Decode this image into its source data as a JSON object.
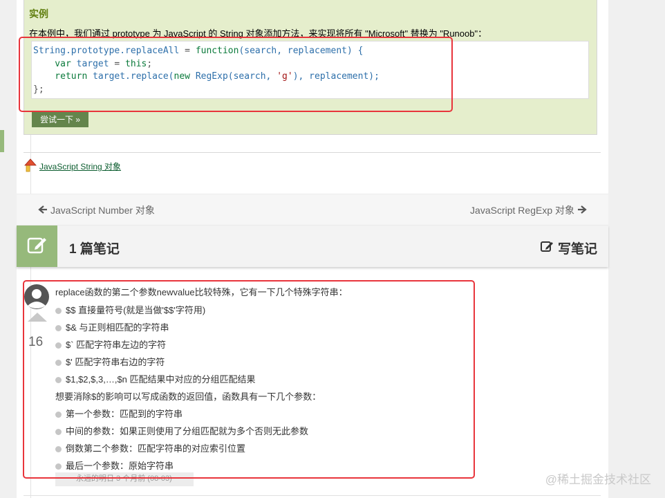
{
  "example": {
    "title": "实例",
    "description": "在本例中，我们通过 prototype 为 JavaScript 的 String 对象添加方法，来实现将所有 \"Microsoft\" 替换为 \"Runoob\"：",
    "code": {
      "line1": {
        "a": "String.prototype.replaceAll",
        "b": " = ",
        "c": "function",
        "d": "(search, replacement) {"
      },
      "line2": {
        "a": "    var ",
        "b": "target",
        "c": " = ",
        "d": "this",
        "e": ";"
      },
      "line3": {
        "a": "    return ",
        "b": "target.replace(",
        "c": "new ",
        "d": "RegExp(search, ",
        "e": "'g'",
        "f": "), replacement);"
      },
      "line4": "};"
    },
    "try_button": "尝试一下 »"
  },
  "back_link": "JavaScript String 对象",
  "nav": {
    "prev": "JavaScript Number 对象",
    "next": "JavaScript RegExp 对象"
  },
  "notes": {
    "count_label": "1 篇笔记",
    "write_label": "写笔记"
  },
  "note": {
    "votes": "16",
    "intro": "replace函数的第二个参数newvalue比较特殊，它有一下几个特殊字符串：",
    "special_items": [
      "$$  直接量符号(就是当做'$$'字符用)",
      "$&  与正则相匹配的字符串",
      "$`  匹配字符串左边的字符",
      "$'  匹配字符串右边的字符",
      "$1,$2,$,3,…,$n  匹配结果中对应的分组匹配结果"
    ],
    "func_intro": "想要消除$的影响可以写成函数的返回值，函数具有一下几个参数：",
    "func_items": [
      "第一个参数：匹配到的字符串",
      "中间的参数：如果正则使用了分组匹配就为多个否则无此参数",
      "倒数第二个参数：匹配字符串的对应索引位置",
      "最后一个参数：原始字符串"
    ],
    "author": "永远的明日 3 个月前 (08-03)"
  },
  "watermark": "@稀土掘金技术社区",
  "colors": {
    "red_highlight": "#e8343b",
    "green_accent": "#96b97b",
    "example_bg": "#e5eecc"
  }
}
